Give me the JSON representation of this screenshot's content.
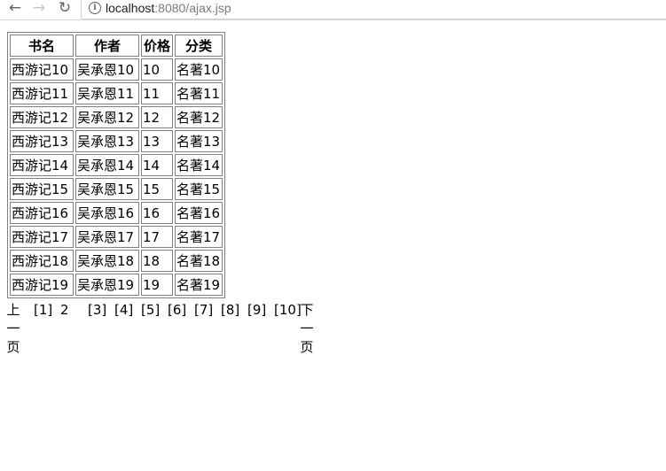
{
  "browser": {
    "back_icon": "arrow-left-icon",
    "forward_icon": "arrow-right-icon",
    "reload_icon": "reload-icon",
    "info_icon": "info-icon",
    "url_host": "localhost",
    "url_rest": ":8080/ajax.jsp"
  },
  "table": {
    "headers": [
      "书名",
      "作者",
      "价格",
      "分类"
    ],
    "rows": [
      [
        "西游记10",
        "吴承恩10",
        "10",
        "名著10"
      ],
      [
        "西游记11",
        "吴承恩11",
        "11",
        "名著11"
      ],
      [
        "西游记12",
        "吴承恩12",
        "12",
        "名著12"
      ],
      [
        "西游记13",
        "吴承恩13",
        "13",
        "名著13"
      ],
      [
        "西游记14",
        "吴承恩14",
        "14",
        "名著14"
      ],
      [
        "西游记15",
        "吴承恩15",
        "15",
        "名著15"
      ],
      [
        "西游记16",
        "吴承恩16",
        "16",
        "名著16"
      ],
      [
        "西游记17",
        "吴承恩17",
        "17",
        "名著17"
      ],
      [
        "西游记18",
        "吴承恩18",
        "18",
        "名著18"
      ],
      [
        "西游记19",
        "吴承恩19",
        "19",
        "名著19"
      ]
    ]
  },
  "pager": {
    "prev": "上一页",
    "current": "2",
    "pages": [
      "[1]",
      "[3]",
      "[4]",
      "[5]",
      "[6]",
      "[7]",
      "[8]",
      "[9]",
      "[10]"
    ],
    "next": "下一页"
  }
}
